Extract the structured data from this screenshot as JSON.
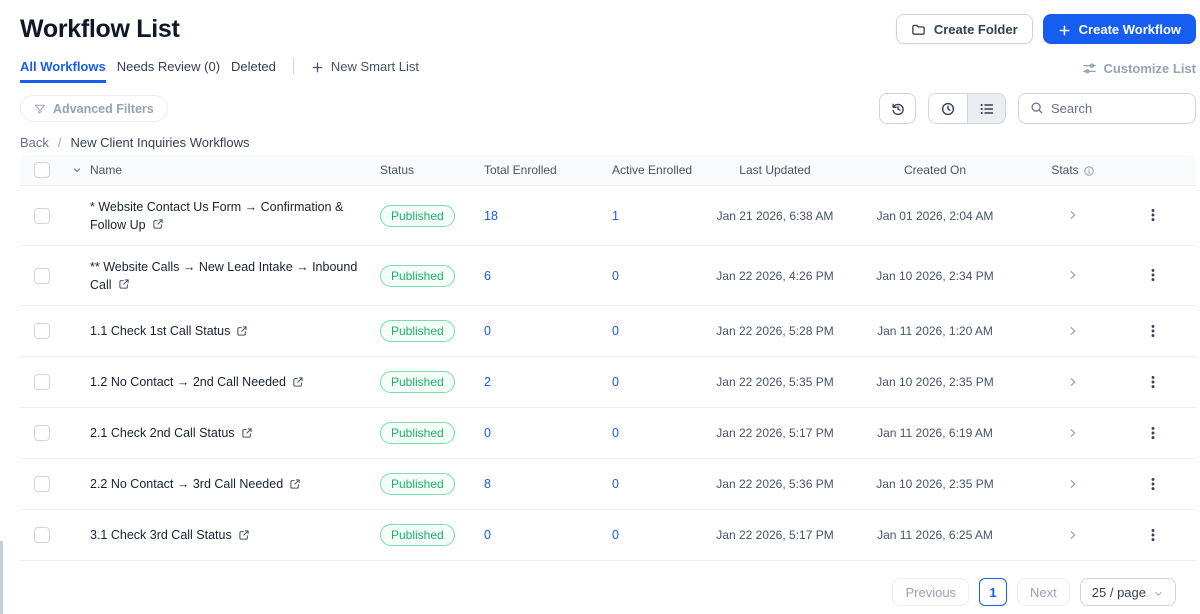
{
  "page": {
    "title": "Workflow List"
  },
  "header": {
    "create_folder_label": "Create Folder",
    "create_workflow_label": "Create Workflow"
  },
  "tabs": {
    "items": [
      {
        "label": "All Workflows",
        "active": true
      },
      {
        "label": "Needs Review (0)",
        "active": false
      },
      {
        "label": "Deleted",
        "active": false
      }
    ],
    "new_smart_list_label": "New Smart List",
    "customize_list_label": "Customize List"
  },
  "filters": {
    "advanced_filters_label": "Advanced Filters",
    "search_placeholder": "Search"
  },
  "breadcrumb": {
    "back": "Back",
    "separator": "/",
    "current": "New Client Inquiries Workflows"
  },
  "table": {
    "columns": {
      "name": "Name",
      "status": "Status",
      "total_enrolled": "Total Enrolled",
      "active_enrolled": "Active Enrolled",
      "last_updated": "Last Updated",
      "created_on": "Created On",
      "stats": "Stats"
    },
    "rows": [
      {
        "name": "* Website Contact Us Form → Confirmation & Follow Up",
        "status": "Published",
        "total_enrolled": "18",
        "active_enrolled": "1",
        "last_updated": "Jan 21 2026, 6:38 AM",
        "created_on": "Jan 01 2026, 2:04 AM",
        "tall": true
      },
      {
        "name": "** Website Calls → New Lead Intake → Inbound Call",
        "status": "Published",
        "total_enrolled": "6",
        "active_enrolled": "0",
        "last_updated": "Jan 22 2026, 4:26 PM",
        "created_on": "Jan 10 2026, 2:34 PM",
        "tall": true
      },
      {
        "name": "1.1 Check 1st Call Status",
        "status": "Published",
        "total_enrolled": "0",
        "active_enrolled": "0",
        "last_updated": "Jan 22 2026, 5:28 PM",
        "created_on": "Jan 11 2026, 1:20 AM",
        "tall": false
      },
      {
        "name": "1.2 No Contact → 2nd Call Needed",
        "status": "Published",
        "total_enrolled": "2",
        "active_enrolled": "0",
        "last_updated": "Jan 22 2026, 5:35 PM",
        "created_on": "Jan 10 2026, 2:35 PM",
        "tall": false
      },
      {
        "name": "2.1 Check 2nd Call Status",
        "status": "Published",
        "total_enrolled": "0",
        "active_enrolled": "0",
        "last_updated": "Jan 22 2026, 5:17 PM",
        "created_on": "Jan 11 2026, 6:19 AM",
        "tall": false
      },
      {
        "name": "2.2 No Contact → 3rd Call Needed",
        "status": "Published",
        "total_enrolled": "8",
        "active_enrolled": "0",
        "last_updated": "Jan 22 2026, 5:36 PM",
        "created_on": "Jan 10 2026, 2:35 PM",
        "tall": false
      },
      {
        "name": "3.1 Check 3rd Call Status",
        "status": "Published",
        "total_enrolled": "0",
        "active_enrolled": "0",
        "last_updated": "Jan 22 2026, 5:17 PM",
        "created_on": "Jan 11 2026, 6:25 AM",
        "tall": false
      }
    ]
  },
  "pagination": {
    "previous_label": "Previous",
    "current_page": "1",
    "next_label": "Next",
    "page_size_label": "25 / page"
  },
  "icons": [
    "folder-icon",
    "plus-icon",
    "sliders-icon",
    "funnel-icon",
    "enrollment-history-icon",
    "clock-icon",
    "list-view-icon",
    "search-icon",
    "info-icon",
    "external-link-icon",
    "chevron-down-icon",
    "chevron-right-icon",
    "kebab-menu-icon"
  ],
  "colors": {
    "primary_blue": "#155EEF",
    "success_text": "#17B26A",
    "success_border": "#75E0A7",
    "success_bg": "#F6FEF9",
    "header_bg": "#F9FAFB",
    "border": "#EAECF0",
    "text_dark": "#101828",
    "text_gray": "#475467",
    "text_muted": "#98A2B3"
  }
}
